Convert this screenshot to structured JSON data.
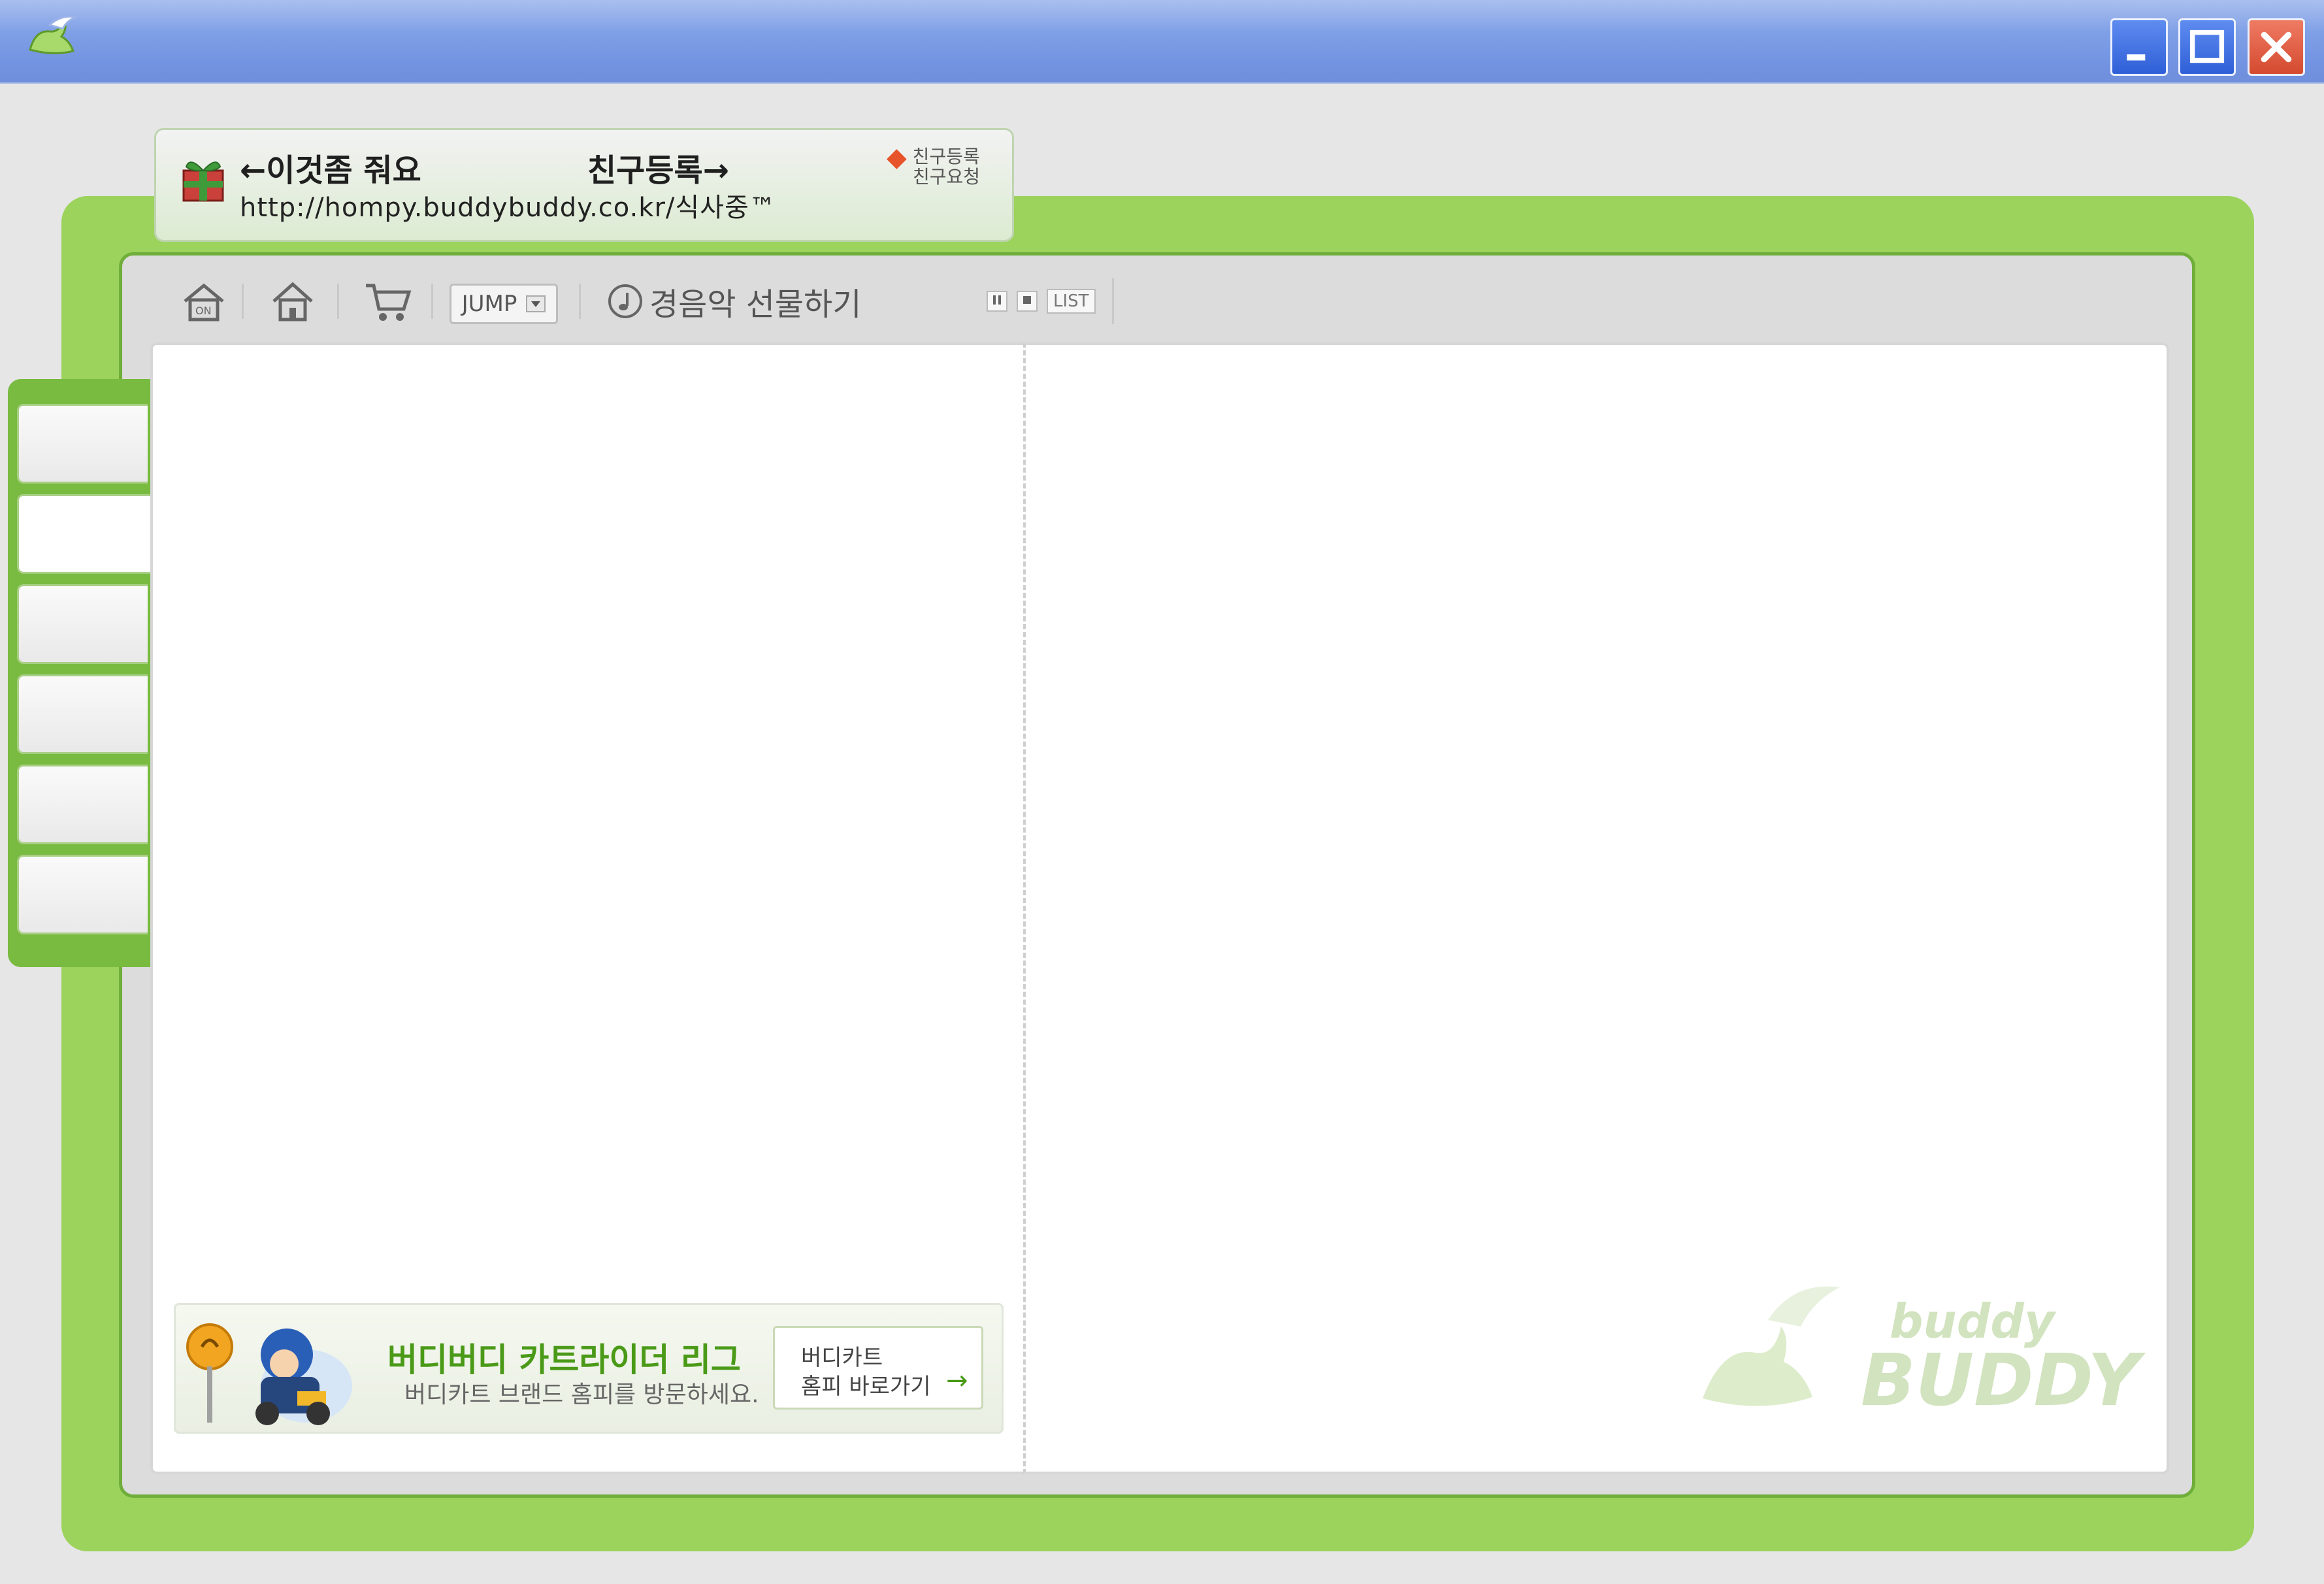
{
  "window": {
    "title": "",
    "accent_color": "#7394e2",
    "controls": [
      "minimize-icon",
      "maximize-icon",
      "close-icon"
    ]
  },
  "notification": {
    "give_text": "←이것좀 줘요",
    "register_text": "친구등록→",
    "url_text": "http://hompy.buddybuddy.co.kr/식사중™",
    "badge_line1": "친구등록",
    "badge_line2": "친구요청"
  },
  "toolbar": {
    "items": [
      "home-icon",
      "house-icon",
      "cart-icon"
    ],
    "jump_label": "JUMP",
    "music_label": "경음악 선물하기",
    "list_label": "LIST"
  },
  "sidebar": {
    "tabs": 6
  },
  "banner": {
    "title": "버디버디 카트라이더 리그",
    "subtitle": "버디카트 브랜드 홈피를 방문하세요.",
    "button_line1": "버디카트",
    "button_line2": "홈피 바로가기",
    "accent_color": "#4a9a18"
  },
  "watermark": {
    "line1": "buddy",
    "line2": "BUDDY"
  },
  "colors": {
    "frame_green": "#9cd35c",
    "frame_dark_green": "#6fae3a",
    "tab_green": "#78bb40"
  }
}
